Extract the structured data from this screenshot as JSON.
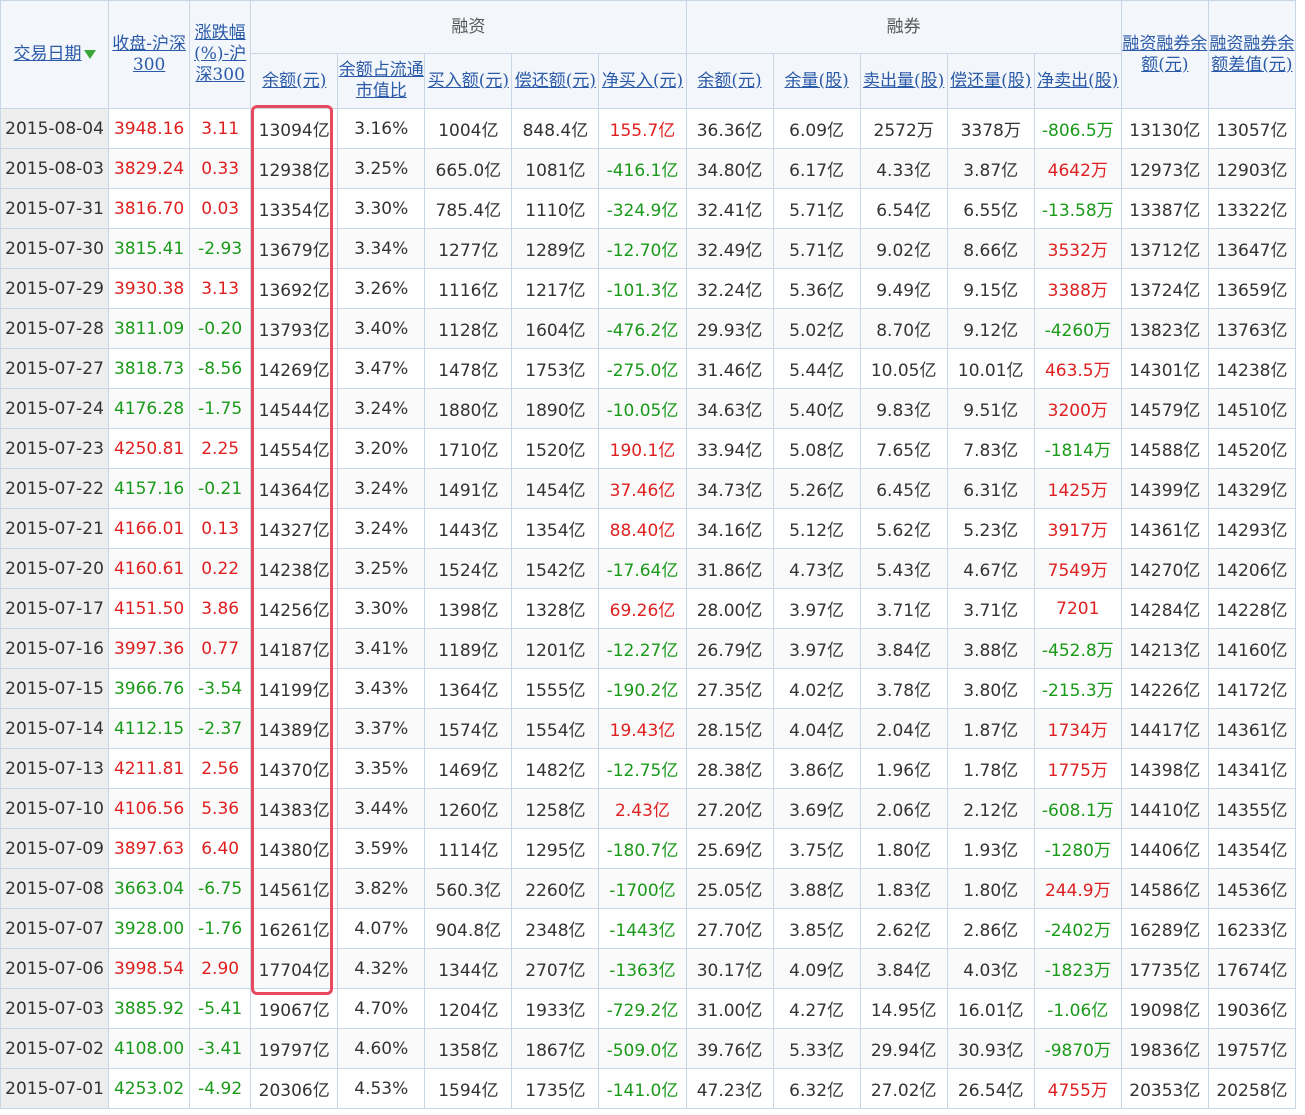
{
  "header": {
    "date": "交易日期",
    "close": "收盘-沪深300",
    "change": "涨跌幅(%)-沪深300",
    "margin_group": "融资",
    "short_group": "融券",
    "margin_cols": [
      "余额(元)",
      "余额占流通市值比",
      "买入额(元)",
      "偿还额(元)",
      "净买入(元)"
    ],
    "short_cols": [
      "余额(元)",
      "余量(股)",
      "卖出量(股)",
      "偿还量(股)",
      "净卖出(股)"
    ],
    "total": "融资融券余额(元)",
    "diff": "融资融券余额差值(元)"
  },
  "colors": {
    "up": "#e02020",
    "down": "#1a9a1a",
    "highlight": "#e8495f",
    "link": "#2b5aa8"
  },
  "rows": [
    [
      "2015-08-04",
      "3948.16",
      "3.11",
      "13094亿",
      "3.16%",
      "1004亿",
      "848.4亿",
      "155.7亿",
      "36.36亿",
      "6.09亿",
      "2572万",
      "3378万",
      "-806.5万",
      "13130亿",
      "13057亿"
    ],
    [
      "2015-08-03",
      "3829.24",
      "0.33",
      "12938亿",
      "3.25%",
      "665.0亿",
      "1081亿",
      "-416.1亿",
      "34.80亿",
      "6.17亿",
      "4.33亿",
      "3.87亿",
      "4642万",
      "12973亿",
      "12903亿"
    ],
    [
      "2015-07-31",
      "3816.70",
      "0.03",
      "13354亿",
      "3.30%",
      "785.4亿",
      "1110亿",
      "-324.9亿",
      "32.41亿",
      "5.71亿",
      "6.54亿",
      "6.55亿",
      "-13.58万",
      "13387亿",
      "13322亿"
    ],
    [
      "2015-07-30",
      "3815.41",
      "-2.93",
      "13679亿",
      "3.34%",
      "1277亿",
      "1289亿",
      "-12.70亿",
      "32.49亿",
      "5.71亿",
      "9.02亿",
      "8.66亿",
      "3532万",
      "13712亿",
      "13647亿"
    ],
    [
      "2015-07-29",
      "3930.38",
      "3.13",
      "13692亿",
      "3.26%",
      "1116亿",
      "1217亿",
      "-101.3亿",
      "32.24亿",
      "5.36亿",
      "9.49亿",
      "9.15亿",
      "3388万",
      "13724亿",
      "13659亿"
    ],
    [
      "2015-07-28",
      "3811.09",
      "-0.20",
      "13793亿",
      "3.40%",
      "1128亿",
      "1604亿",
      "-476.2亿",
      "29.93亿",
      "5.02亿",
      "8.70亿",
      "9.12亿",
      "-4260万",
      "13823亿",
      "13763亿"
    ],
    [
      "2015-07-27",
      "3818.73",
      "-8.56",
      "14269亿",
      "3.47%",
      "1478亿",
      "1753亿",
      "-275.0亿",
      "31.46亿",
      "5.44亿",
      "10.05亿",
      "10.01亿",
      "463.5万",
      "14301亿",
      "14238亿"
    ],
    [
      "2015-07-24",
      "4176.28",
      "-1.75",
      "14544亿",
      "3.24%",
      "1880亿",
      "1890亿",
      "-10.05亿",
      "34.63亿",
      "5.40亿",
      "9.83亿",
      "9.51亿",
      "3200万",
      "14579亿",
      "14510亿"
    ],
    [
      "2015-07-23",
      "4250.81",
      "2.25",
      "14554亿",
      "3.20%",
      "1710亿",
      "1520亿",
      "190.1亿",
      "33.94亿",
      "5.08亿",
      "7.65亿",
      "7.83亿",
      "-1814万",
      "14588亿",
      "14520亿"
    ],
    [
      "2015-07-22",
      "4157.16",
      "-0.21",
      "14364亿",
      "3.24%",
      "1491亿",
      "1454亿",
      "37.46亿",
      "34.73亿",
      "5.26亿",
      "6.45亿",
      "6.31亿",
      "1425万",
      "14399亿",
      "14329亿"
    ],
    [
      "2015-07-21",
      "4166.01",
      "0.13",
      "14327亿",
      "3.24%",
      "1443亿",
      "1354亿",
      "88.40亿",
      "34.16亿",
      "5.12亿",
      "5.62亿",
      "5.23亿",
      "3917万",
      "14361亿",
      "14293亿"
    ],
    [
      "2015-07-20",
      "4160.61",
      "0.22",
      "14238亿",
      "3.25%",
      "1524亿",
      "1542亿",
      "-17.64亿",
      "31.86亿",
      "4.73亿",
      "5.43亿",
      "4.67亿",
      "7549万",
      "14270亿",
      "14206亿"
    ],
    [
      "2015-07-17",
      "4151.50",
      "3.86",
      "14256亿",
      "3.30%",
      "1398亿",
      "1328亿",
      "69.26亿",
      "28.00亿",
      "3.97亿",
      "3.71亿",
      "3.71亿",
      "7201",
      "14284亿",
      "14228亿"
    ],
    [
      "2015-07-16",
      "3997.36",
      "0.77",
      "14187亿",
      "3.41%",
      "1189亿",
      "1201亿",
      "-12.27亿",
      "26.79亿",
      "3.97亿",
      "3.84亿",
      "3.88亿",
      "-452.8万",
      "14213亿",
      "14160亿"
    ],
    [
      "2015-07-15",
      "3966.76",
      "-3.54",
      "14199亿",
      "3.43%",
      "1364亿",
      "1555亿",
      "-190.2亿",
      "27.35亿",
      "4.02亿",
      "3.78亿",
      "3.80亿",
      "-215.3万",
      "14226亿",
      "14172亿"
    ],
    [
      "2015-07-14",
      "4112.15",
      "-2.37",
      "14389亿",
      "3.37%",
      "1574亿",
      "1554亿",
      "19.43亿",
      "28.15亿",
      "4.04亿",
      "2.04亿",
      "1.87亿",
      "1734万",
      "14417亿",
      "14361亿"
    ],
    [
      "2015-07-13",
      "4211.81",
      "2.56",
      "14370亿",
      "3.35%",
      "1469亿",
      "1482亿",
      "-12.75亿",
      "28.38亿",
      "3.86亿",
      "1.96亿",
      "1.78亿",
      "1775万",
      "14398亿",
      "14341亿"
    ],
    [
      "2015-07-10",
      "4106.56",
      "5.36",
      "14383亿",
      "3.44%",
      "1260亿",
      "1258亿",
      "2.43亿",
      "27.20亿",
      "3.69亿",
      "2.06亿",
      "2.12亿",
      "-608.1万",
      "14410亿",
      "14355亿"
    ],
    [
      "2015-07-09",
      "3897.63",
      "6.40",
      "14380亿",
      "3.59%",
      "1114亿",
      "1295亿",
      "-180.7亿",
      "25.69亿",
      "3.75亿",
      "1.80亿",
      "1.93亿",
      "-1280万",
      "14406亿",
      "14354亿"
    ],
    [
      "2015-07-08",
      "3663.04",
      "-6.75",
      "14561亿",
      "3.82%",
      "560.3亿",
      "2260亿",
      "-1700亿",
      "25.05亿",
      "3.88亿",
      "1.83亿",
      "1.80亿",
      "244.9万",
      "14586亿",
      "14536亿"
    ],
    [
      "2015-07-07",
      "3928.00",
      "-1.76",
      "16261亿",
      "4.07%",
      "904.8亿",
      "2348亿",
      "-1443亿",
      "27.70亿",
      "3.85亿",
      "2.62亿",
      "2.86亿",
      "-2402万",
      "16289亿",
      "16233亿"
    ],
    [
      "2015-07-06",
      "3998.54",
      "2.90",
      "17704亿",
      "4.32%",
      "1344亿",
      "2707亿",
      "-1363亿",
      "30.17亿",
      "4.09亿",
      "3.84亿",
      "4.03亿",
      "-1823万",
      "17735亿",
      "17674亿"
    ],
    [
      "2015-07-03",
      "3885.92",
      "-5.41",
      "19067亿",
      "4.70%",
      "1204亿",
      "1933亿",
      "-729.2亿",
      "31.00亿",
      "4.27亿",
      "14.95亿",
      "16.01亿",
      "-1.06亿",
      "19098亿",
      "19036亿"
    ],
    [
      "2015-07-02",
      "4108.00",
      "-3.41",
      "19797亿",
      "4.60%",
      "1358亿",
      "1867亿",
      "-509.0亿",
      "39.76亿",
      "5.33亿",
      "29.94亿",
      "30.93亿",
      "-9870万",
      "19836亿",
      "19757亿"
    ],
    [
      "2015-07-01",
      "4253.02",
      "-4.92",
      "20306亿",
      "4.53%",
      "1594亿",
      "1735亿",
      "-141.0亿",
      "47.23亿",
      "6.32亿",
      "27.02亿",
      "26.54亿",
      "4755万",
      "20353亿",
      "20258亿"
    ]
  ]
}
